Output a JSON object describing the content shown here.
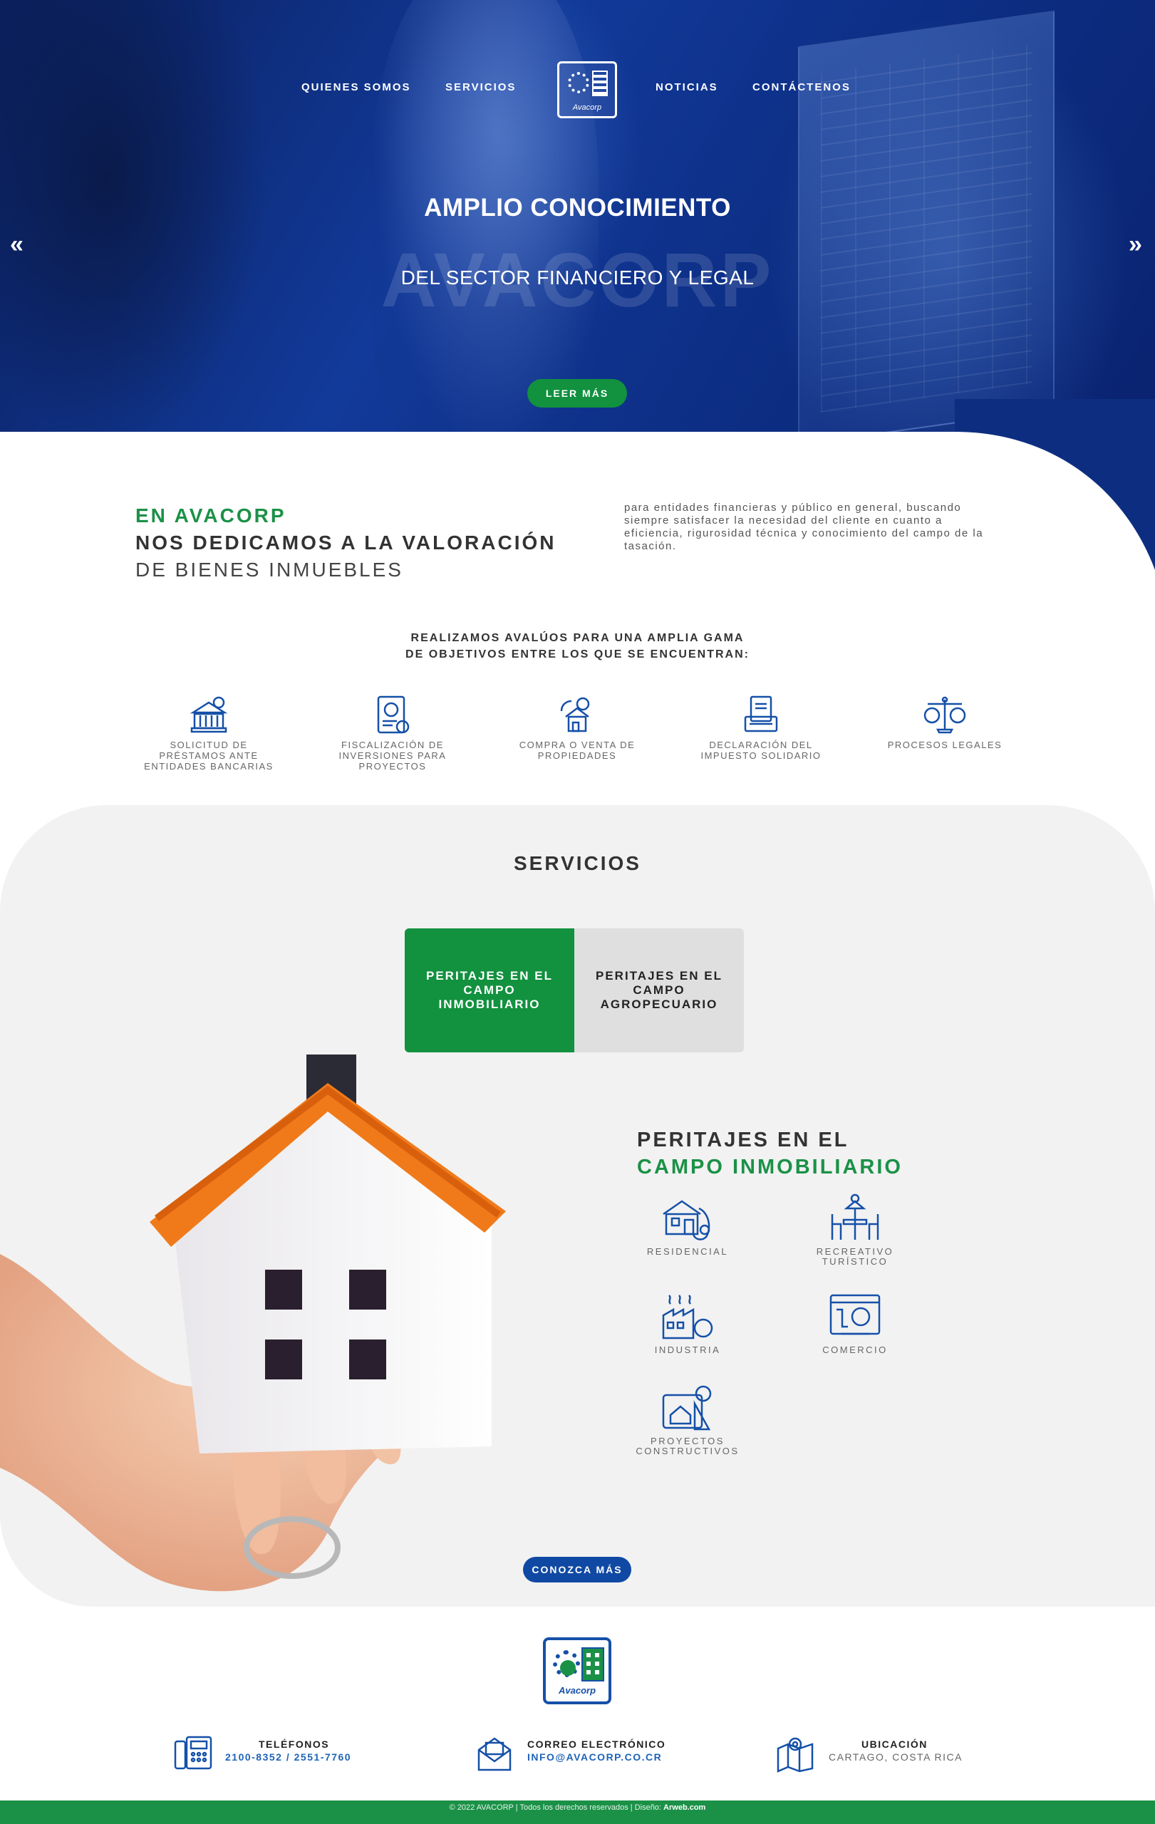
{
  "nav": {
    "left": [
      "QUIENES SOMOS",
      "SERVICIOS"
    ],
    "right": [
      "NOTICIAS",
      "CONTÁCTENOS"
    ],
    "logo_text": "Avacorp"
  },
  "hero": {
    "title": "AMPLIO CONOCIMIENTO",
    "watermark": "AVACORP",
    "subtitle": "DEL SECTOR FINANCIERO Y LEGAL",
    "cta": "LEER MÁS",
    "prev_arrow": "«",
    "next_arrow": "»"
  },
  "about": {
    "line1": "EN AVACORP",
    "line2": "NOS DEDICAMOS A LA VALORACIÓN",
    "line3": "DE BIENES INMUEBLES",
    "paragraph": "para entidades financieras y público en general, buscando siempre satisfacer la necesidad del cliente en cuanto a eficiencia, rigurosidad técnica y conocimiento del campo de la tasación."
  },
  "objectives": {
    "heading_line1": "REALIZAMOS AVALÚOS PARA UNA AMPLIA GAMA",
    "heading_line2": "DE OBJETIVOS ENTRE LOS QUE SE ENCUENTRAN:",
    "items": [
      {
        "label": "SOLICITUD DE PRÉSTAMOS ANTE ENTIDADES BANCARIAS",
        "icon": "bank-icon"
      },
      {
        "label": "FISCALIZACIÓN DE INVERSIONES PARA PROYECTOS",
        "icon": "tablet-chart-icon"
      },
      {
        "label": "COMPRA O VENTA DE PROPIEDADES",
        "icon": "house-exchange-icon"
      },
      {
        "label": "DECLARACIÓN DEL IMPUESTO SOLIDARIO",
        "icon": "tax-document-icon"
      },
      {
        "label": "PROCESOS LEGALES",
        "icon": "scale-icon"
      }
    ]
  },
  "services": {
    "title": "SERVICIOS",
    "tabs": [
      {
        "label": "PERITAJES EN EL CAMPO INMOBILIARIO",
        "active": true
      },
      {
        "label": "PERITAJES EN EL CAMPO AGROPECUARIO",
        "active": false
      }
    ],
    "panel_title_1": "PERITAJES EN EL",
    "panel_title_2": "CAMPO INMOBILIARIO",
    "items": [
      {
        "label": "RESIDENCIAL",
        "icon": "residential-icon"
      },
      {
        "label": "RECREATIVO TURÍSTICO",
        "icon": "recreation-icon"
      },
      {
        "label": "INDUSTRIA",
        "icon": "factory-icon"
      },
      {
        "label": "COMERCIO",
        "icon": "commerce-icon"
      },
      {
        "label": "PROYECTOS CONSTRUCTIVOS",
        "icon": "blueprint-icon"
      }
    ],
    "cta": "CONOZCA MÁS"
  },
  "footer": {
    "logo_text": "Avacorp",
    "phones": {
      "title": "TELÉFONOS",
      "value": "2100-8352 / 2551-7760"
    },
    "email": {
      "title": "CORREO ELECTRÓNICO",
      "value": "INFO@AVACORP.CO.CR"
    },
    "location": {
      "title": "UBICACIÓN",
      "value": "CARTAGO, COSTA RICA"
    },
    "copyright": "© 2022 AVACORP | Todos los derechos reservados | Diseño:",
    "designer": "Arweb.com"
  },
  "colors": {
    "green": "#12913f",
    "blue": "#0f49a3",
    "hero_blue": "#123a9a",
    "light_gray": "#f2f2f2"
  }
}
